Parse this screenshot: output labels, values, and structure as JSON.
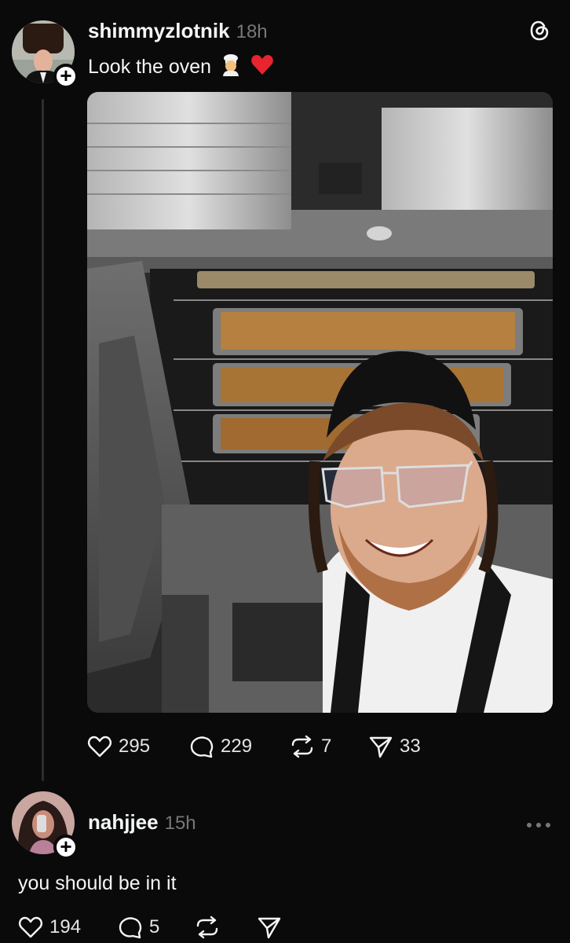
{
  "post": {
    "username": "shimmyzlotnik",
    "time": "18h",
    "text": "Look the oven",
    "emojis": [
      "cook-emoji",
      "red-heart-emoji"
    ],
    "stats": {
      "likes": "295",
      "replies": "229",
      "reposts": "7",
      "shares": "33"
    }
  },
  "reply": {
    "username": "nahjjee",
    "time": "15h",
    "text": "you should be in it",
    "stats": {
      "likes": "194",
      "replies": "5"
    }
  },
  "icons": {
    "app_logo": "threads-logo-icon",
    "like": "heart-icon",
    "reply": "speech-bubble-icon",
    "repost": "repost-icon",
    "share": "send-icon",
    "more": "more-dots-icon"
  },
  "colors": {
    "background": "#0a0a0a",
    "text": "#f3f5f7",
    "muted": "#777777"
  }
}
